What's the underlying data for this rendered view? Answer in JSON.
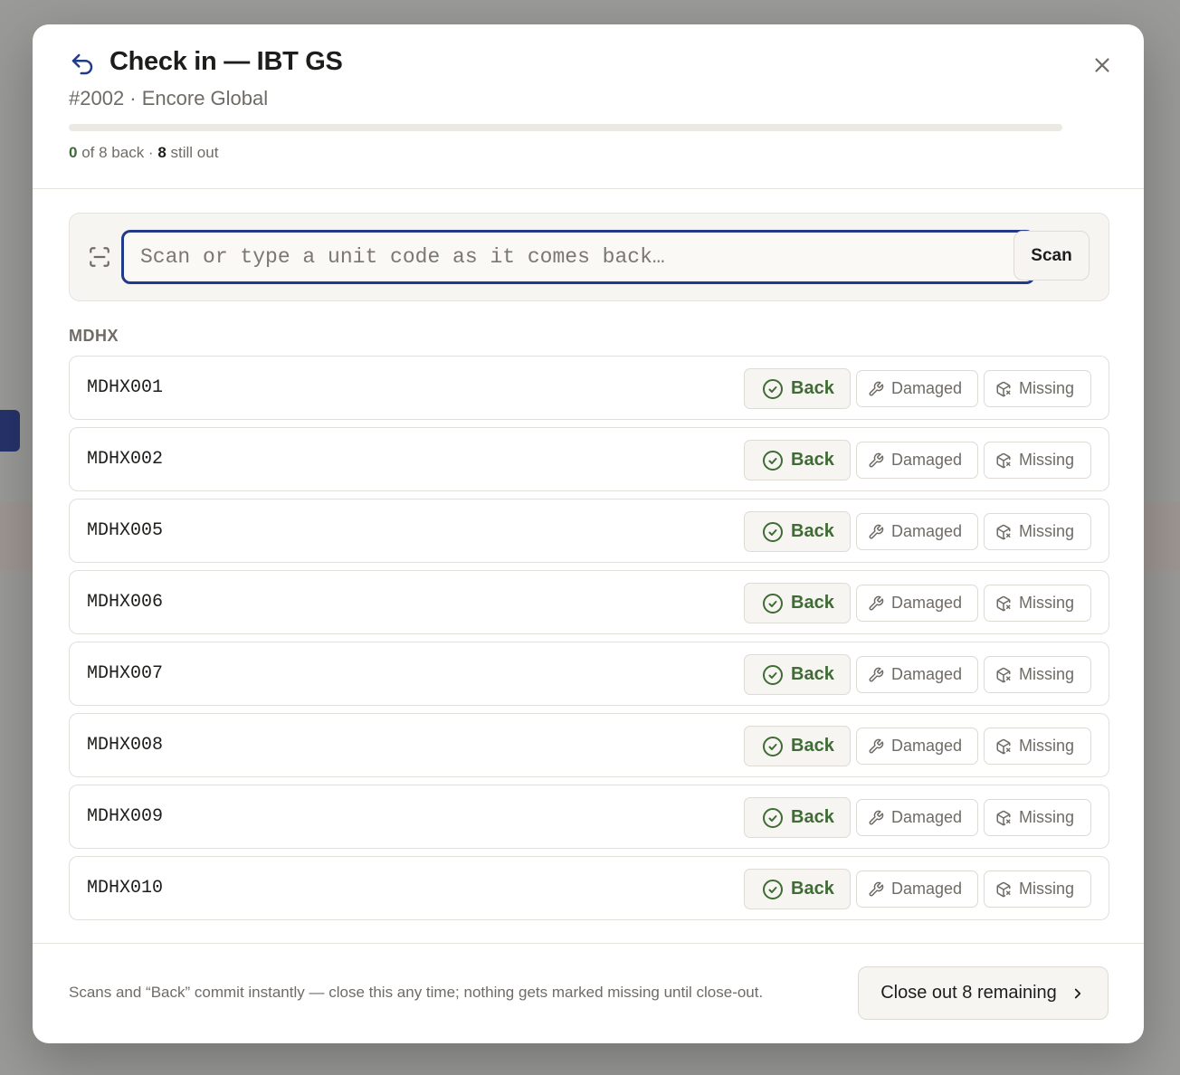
{
  "header": {
    "title": "Check in — IBT GS",
    "subtitle": "#2002 · Encore Global",
    "progress_fraction": 0,
    "stats": {
      "back_count": "0",
      "back_text": "of 8 back ·",
      "out_count": "8",
      "out_text": "still out"
    }
  },
  "scan": {
    "placeholder": "Scan or type a unit code as it comes back…",
    "button_label": "Scan"
  },
  "group": {
    "label": "MDHX"
  },
  "actions": {
    "back": "Back",
    "damaged": "Damaged",
    "missing": "Missing"
  },
  "units": [
    {
      "code": "MDHX001"
    },
    {
      "code": "MDHX002"
    },
    {
      "code": "MDHX005"
    },
    {
      "code": "MDHX006"
    },
    {
      "code": "MDHX007"
    },
    {
      "code": "MDHX008"
    },
    {
      "code": "MDHX009"
    },
    {
      "code": "MDHX010"
    }
  ],
  "footer": {
    "note": "Scans and “Back” commit instantly — close this any time; nothing gets marked missing until close-out.",
    "closeout_label": "Close out 8 remaining"
  },
  "icons": [
    "undo-icon",
    "close-icon",
    "scan-icon",
    "check-circle-icon",
    "wrench-icon",
    "package-x-icon",
    "chevron-right-icon"
  ],
  "colors": {
    "accent": "#233a8a",
    "success": "#3f6b35",
    "muted": "#6f6b66"
  }
}
